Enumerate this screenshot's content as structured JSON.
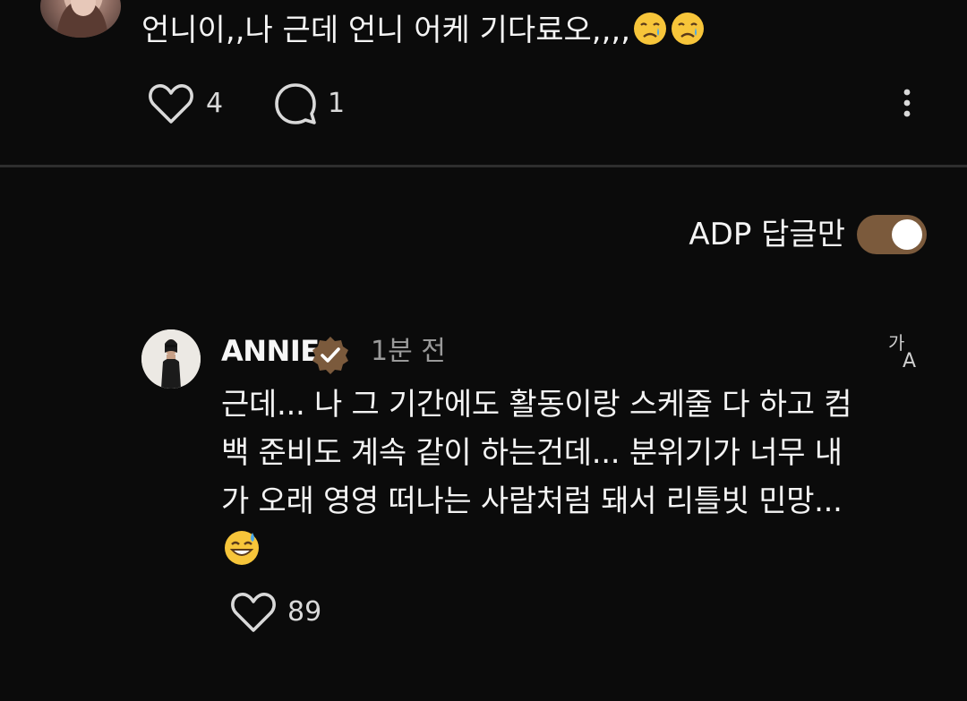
{
  "top_comment": {
    "text": "언니이,,나 근데 언니 어케 기다료오,,,,",
    "emojis": [
      "crying-face-emoji",
      "crying-face-emoji"
    ],
    "likes": "4",
    "replies": "1"
  },
  "filter": {
    "label": "ADP 답글만",
    "toggle_on": true,
    "accent": "#7b5a3c"
  },
  "reply": {
    "author": "ANNIE",
    "verified": true,
    "time": "1분 전",
    "body": "근데... 나 그 기간에도 활동이랑 스케줄 다 하고 컴백 준비도 계속 같이 하는건데... 분위기가 너무 내가 오래 영영 떠나는 사람처럼 돼서 리틀빗 민망...",
    "emoji": "grinning-sweat-emoji",
    "likes": "89"
  }
}
